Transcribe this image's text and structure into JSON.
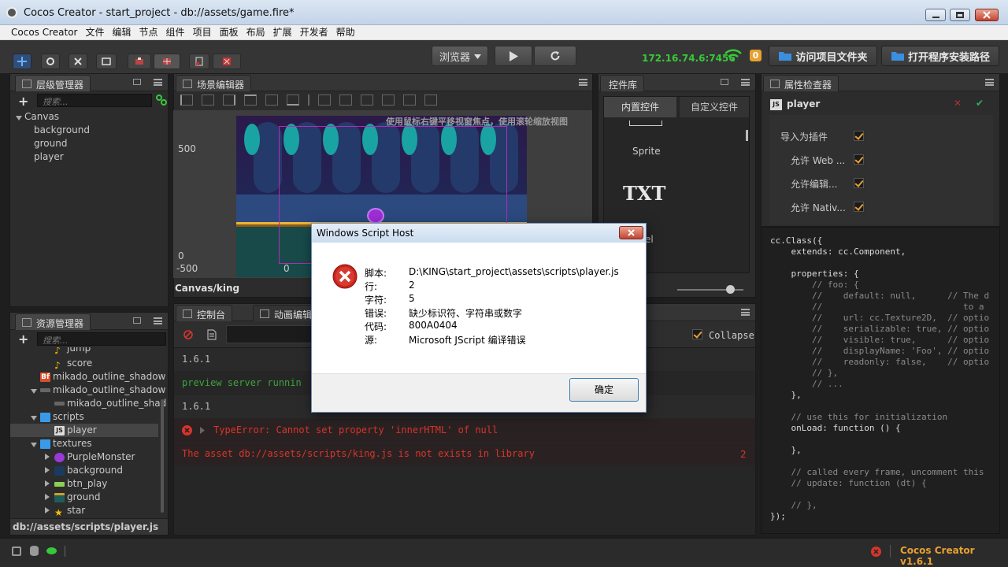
{
  "window": {
    "title": "Cocos Creator - start_project - db://assets/game.fire*"
  },
  "menu": [
    "Cocos Creator",
    "文件",
    "编辑",
    "节点",
    "组件",
    "项目",
    "面板",
    "布局",
    "扩展",
    "开发者",
    "帮助"
  ],
  "toolbar": {
    "browser_select": "浏览器",
    "ip": "172.16.74.6:7456",
    "badge": "0",
    "open_project_folder": "访问项目文件夹",
    "open_install_path": "打开程序安装路径"
  },
  "hierarchy": {
    "tab": "层级管理器",
    "search_placeholder": "搜索...",
    "root": "Canvas",
    "children": [
      "background",
      "ground",
      "player"
    ]
  },
  "scene": {
    "tab": "场景编辑器",
    "hint": "使用鼠标右键平移视窗焦点，使用滚轮缩放视图",
    "ruler_y": [
      "500",
      "0"
    ],
    "ruler_x": [
      "-500",
      "0"
    ],
    "breadcrumb": "Canvas/king"
  },
  "widgets": {
    "tab": "控件库",
    "tab_builtin": "内置控件",
    "tab_custom": "自定义控件",
    "sprite": "Sprite",
    "txt": "TXT",
    "label_partial": "el"
  },
  "assets": {
    "tab": "资源管理器",
    "search_placeholder": "搜索...",
    "items": [
      {
        "label": "jump",
        "icon": "music-icon"
      },
      {
        "label": "score",
        "icon": "music-icon"
      },
      {
        "label": "mikado_outline_shadow",
        "icon": "bitmap-font-icon"
      },
      {
        "label": "mikado_outline_shadow",
        "icon": "texture-icon"
      },
      {
        "label": "mikado_outline_shad",
        "icon": "texture-icon"
      },
      {
        "label": "scripts",
        "icon": "folder-icon"
      },
      {
        "label": "player",
        "icon": "js-icon"
      },
      {
        "label": "textures",
        "icon": "folder-icon"
      },
      {
        "label": "PurpleMonster",
        "icon": "texture-icon"
      },
      {
        "label": "background",
        "icon": "texture-icon"
      },
      {
        "label": "btn_play",
        "icon": "texture-icon"
      },
      {
        "label": "ground",
        "icon": "texture-icon"
      },
      {
        "label": "star",
        "icon": "texture-icon"
      }
    ],
    "path": "db://assets/scripts/player.js"
  },
  "console": {
    "tab": "控制台",
    "tab2": "动画编辑",
    "collapse": "Collapse",
    "lines": [
      {
        "text": "1.6.1",
        "type": "log"
      },
      {
        "text": "preview server runnin",
        "type": "success"
      },
      {
        "text": "1.6.1",
        "type": "log"
      },
      {
        "text": "TypeError: Cannot set property 'innerHTML' of null",
        "type": "error"
      },
      {
        "text": "The asset db://assets/scripts/king.js is not exists in library",
        "type": "error",
        "count": "2"
      }
    ]
  },
  "inspector": {
    "tab": "属性检查器",
    "asset_name": "player",
    "props": [
      {
        "label": "导入为插件",
        "checked": true
      },
      {
        "label": "允许 Web ...",
        "checked": true
      },
      {
        "label": "允许编辑...",
        "checked": true
      },
      {
        "label": "允许 Nativ...",
        "checked": true
      }
    ]
  },
  "code": {
    "lines": [
      "cc.Class({",
      "    extends: cc.Component,",
      "",
      "    properties: {",
      "        // foo: {",
      "        //    default: null,      // The d",
      "        //                           to a",
      "        //    url: cc.Texture2D,  // optio",
      "        //    serializable: true, // optio",
      "        //    visible: true,      // optio",
      "        //    displayName: 'Foo', // optio",
      "        //    readonly: false,    // optio",
      "        // },",
      "        // ...",
      "    },",
      "",
      "    // use this for initialization",
      "    onLoad: function () {",
      "",
      "    },",
      "",
      "    // called every frame, uncomment this",
      "    // update: function (dt) {",
      "",
      "    // },",
      "});"
    ]
  },
  "dialog": {
    "title": "Windows Script Host",
    "rows": [
      {
        "label": "脚本:",
        "value": "D:\\KING\\start_project\\assets\\scripts\\player.js"
      },
      {
        "label": "行:",
        "value": "2"
      },
      {
        "label": "字符:",
        "value": "5"
      },
      {
        "label": "错误:",
        "value": "缺少标识符、字符串或数字"
      },
      {
        "label": "代码:",
        "value": "800A0404"
      },
      {
        "label": "源:",
        "value": "Microsoft JScript 编译错误"
      }
    ],
    "ok": "确定"
  },
  "status": {
    "version": "Cocos Creator v1.6.1"
  },
  "colors": {
    "accent": "#e8a030",
    "ip_green": "#37c83a",
    "error_red": "#d9342b"
  }
}
